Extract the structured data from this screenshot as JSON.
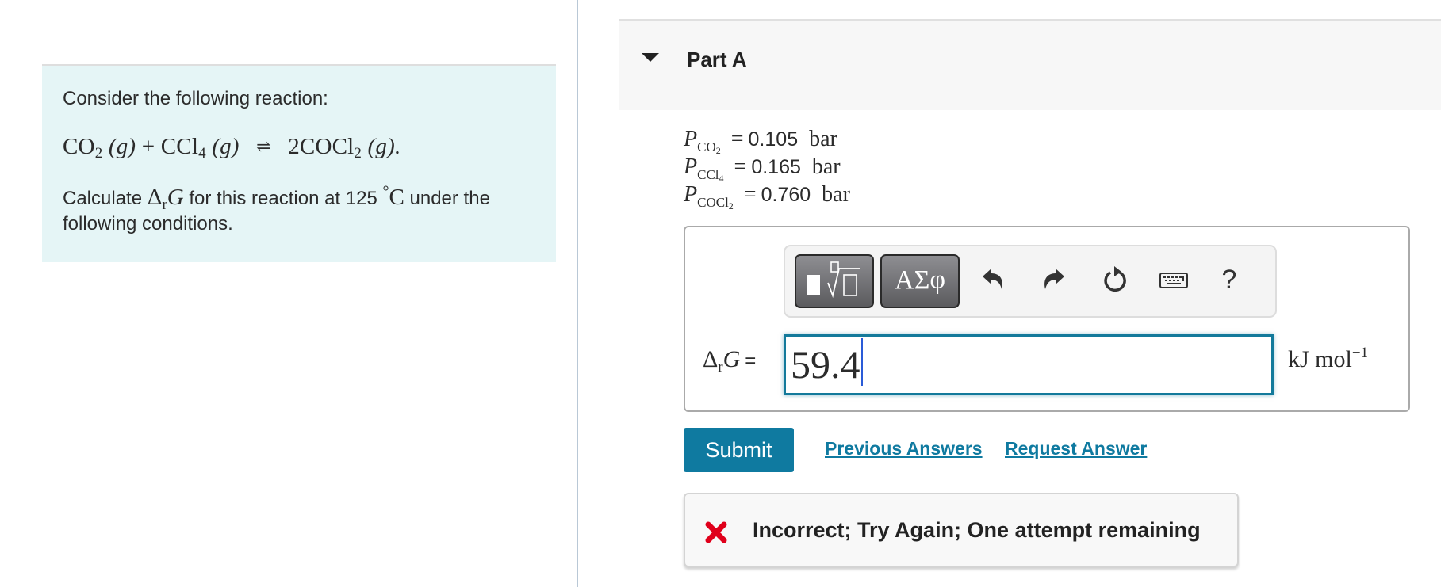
{
  "intro": {
    "line1": "Consider the following reaction:",
    "equation": {
      "reactant1": "CO",
      "reactant1_sub": "2",
      "reactant1_state": "(g)",
      "plus": "+",
      "reactant2": "CCl",
      "reactant2_sub": "4",
      "reactant2_state": "(g)",
      "arrow": "⇌",
      "product": "2COCl",
      "product_sub": "2",
      "product_state": "(g).",
      "phase_symbol": "g"
    },
    "calc_prefix": "Calculate",
    "calc_delta": "Δ",
    "calc_delta_sub": "r",
    "calc_G": "G",
    "calc_mid": "for this reaction at 125",
    "calc_degree": "°",
    "calc_unit": "C",
    "calc_suffix": "under the following conditions."
  },
  "part": {
    "title": "Part A",
    "expanded": true
  },
  "pressures": [
    {
      "symbol": "P",
      "species": "CO",
      "species_sub": "2",
      "value": "0.105",
      "unit": "bar"
    },
    {
      "symbol": "P",
      "species": "CCl",
      "species_sub": "4",
      "value": "0.165",
      "unit": "bar"
    },
    {
      "symbol": "P",
      "species": "COCl",
      "species_sub": "2",
      "value": "0.760",
      "unit": "bar"
    }
  ],
  "toolbar": {
    "symbols_label": "ΑΣφ",
    "help_label": "?"
  },
  "answer": {
    "label_delta": "Δ",
    "label_sub": "r",
    "label_G": "G",
    "label_equals": "=",
    "value": "59.4",
    "units": "kJ mol",
    "units_exp": "−1"
  },
  "actions": {
    "submit": "Submit",
    "previous_answers": "Previous Answers",
    "request_answer": "Request Answer"
  },
  "feedback": {
    "status": "incorrect",
    "message": "Incorrect; Try Again; One attempt remaining",
    "icon_color": "#e0001b"
  },
  "colors": {
    "accent": "#0f7aa0",
    "intro_bg": "#e5f5f6",
    "header_bg": "#f7f7f7"
  }
}
